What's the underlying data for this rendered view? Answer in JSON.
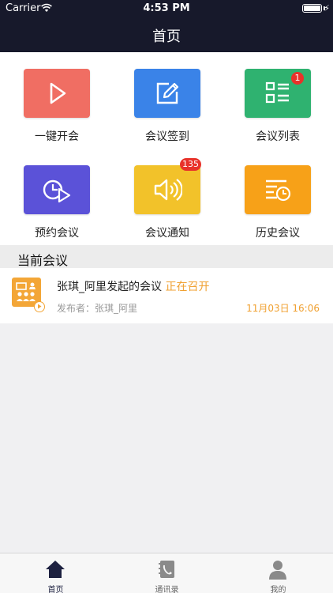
{
  "status_bar": {
    "carrier": "Carrier",
    "time": "4:53 PM"
  },
  "header": {
    "title": "首页"
  },
  "features": [
    {
      "label": "一键开会",
      "icon": "play-icon",
      "color": "#f06e63",
      "badge": ""
    },
    {
      "label": "会议签到",
      "icon": "edit-icon",
      "color": "#3a83e8",
      "badge": ""
    },
    {
      "label": "会议列表",
      "icon": "list-icon",
      "color": "#2fb270",
      "badge": "1"
    },
    {
      "label": "预约会议",
      "icon": "schedule-icon",
      "color": "#5b52d8",
      "badge": ""
    },
    {
      "label": "会议通知",
      "icon": "speaker-icon",
      "color": "#f2c22a",
      "badge": "135"
    },
    {
      "label": "历史会议",
      "icon": "history-icon",
      "color": "#f7a118",
      "badge": ""
    }
  ],
  "current_section": {
    "title": "当前会议"
  },
  "current_meeting": {
    "title": "张琪_阿里发起的会议",
    "status": "正在召开",
    "publisher": "发布者：张琪_阿里",
    "time": "11月03日 16:06",
    "thumb_icon": "meeting-icon"
  },
  "tabbar": [
    {
      "label": "首页",
      "icon": "home-icon",
      "active": true
    },
    {
      "label": "通讯录",
      "icon": "contacts-icon",
      "active": false
    },
    {
      "label": "我的",
      "icon": "profile-icon",
      "active": false
    }
  ],
  "colors": {
    "header_bg": "#17192b",
    "accent": "#f0a030",
    "badge": "#e8322a"
  }
}
